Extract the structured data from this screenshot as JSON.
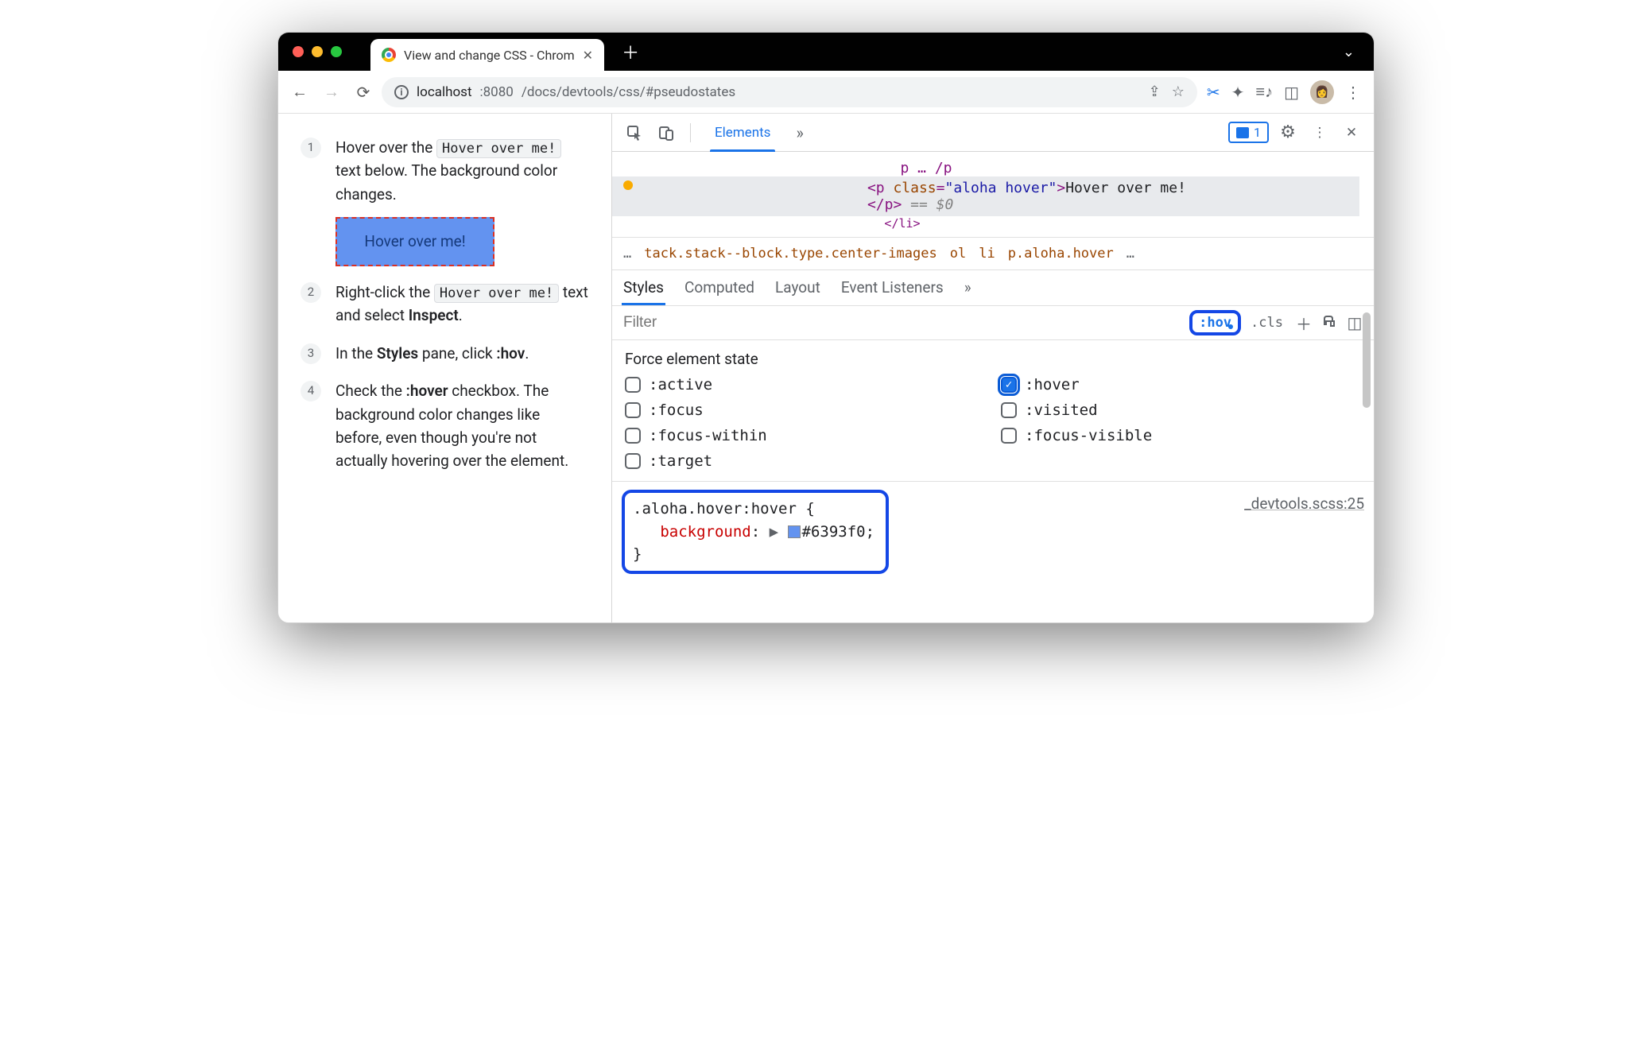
{
  "window": {
    "tab_title": "View and change CSS - Chrom",
    "url_host": "localhost",
    "url_port": ":8080",
    "url_path": "/docs/devtools/css/#pseudostates"
  },
  "tutorial": {
    "steps": [
      {
        "num": "1",
        "pre": "Hover over the ",
        "chip": "Hover over me!",
        "post": " text below. The background color changes."
      },
      {
        "num": "2",
        "pre": "Right-click the ",
        "chip": "Hover over me!",
        "post": " text and select ",
        "bold": "Inspect",
        "tail": "."
      },
      {
        "num": "3",
        "pre": "In the ",
        "bold": "Styles",
        "mid": " pane, click ",
        "bold2": ":hov",
        "tail": "."
      },
      {
        "num": "4",
        "pre": "Check the ",
        "bold": ":hover",
        "post": " checkbox. The background color changes like before, even though you're not actually hovering over the element."
      }
    ],
    "demo_text": "Hover over me!"
  },
  "devtools": {
    "panel_tab": "Elements",
    "issues_count": "1",
    "dom": {
      "line1_pre": "<p ",
      "line1_attr": "class",
      "line1_val": "\"aloha hover\"",
      "line1_gt": ">",
      "line1_text": "Hover over me!",
      "line2": "</p>",
      "eq": " == ",
      "dollar": "$0"
    },
    "crumb": {
      "seg1": "tack.stack--block.type.center-images",
      "seg2": "ol",
      "seg3": "li",
      "seg4": "p.aloha.hover"
    },
    "styles_tabs": [
      "Styles",
      "Computed",
      "Layout",
      "Event Listeners"
    ],
    "filter_placeholder": "Filter",
    "hov_label": ":hov",
    "cls_label": ".cls",
    "force_title": "Force element state",
    "force_states": {
      "active": ":active",
      "hover": ":hover",
      "focus": ":focus",
      "visited": ":visited",
      "focus_within": ":focus-within",
      "focus_visible": ":focus-visible",
      "target": ":target"
    },
    "rule": {
      "selector": ".aloha.hover:hover {",
      "prop": "background",
      "value": "#6393f0;",
      "close": "}"
    },
    "source": "_devtools.scss:25"
  },
  "colors": {
    "demo_bg": "#6393f0",
    "highlight": "#1447e6"
  }
}
